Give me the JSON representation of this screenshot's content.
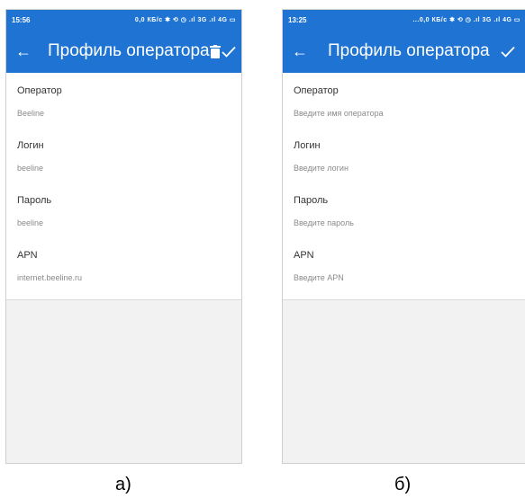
{
  "colors": {
    "accent": "#1f74d3",
    "body_bg": "#f2f2f2"
  },
  "screen_a": {
    "status_time": "15:56",
    "status_icons": "0,0 КБ/с ✱ ⟲ ◷ .ıl 3G .ıl 4G ▭",
    "title": "Профиль оператора",
    "back_icon": "←",
    "icons": [
      "back-arrow-icon",
      "trash-icon",
      "check-icon"
    ],
    "fields": [
      {
        "label": "Оператор",
        "value": "Beeline"
      },
      {
        "label": "Логин",
        "value": "beeline"
      },
      {
        "label": "Пароль",
        "value": "beeline"
      },
      {
        "label": "APN",
        "value": "internet.beeline.ru"
      }
    ],
    "caption": "а)"
  },
  "screen_b": {
    "status_time": "13:25",
    "status_icons": "...0,0 КБ/с ✱ ⟲ ◷ .ıl 3G .ıl 4G ▭",
    "title": "Профиль оператора",
    "back_icon": "←",
    "icons": [
      "back-arrow-icon",
      "check-icon"
    ],
    "fields": [
      {
        "label": "Оператор",
        "placeholder": "Введите имя оператора"
      },
      {
        "label": "Логин",
        "placeholder": "Введите логин"
      },
      {
        "label": "Пароль",
        "placeholder": "Введите пароль"
      },
      {
        "label": "APN",
        "placeholder": "Введите APN"
      }
    ],
    "caption": "б)"
  }
}
